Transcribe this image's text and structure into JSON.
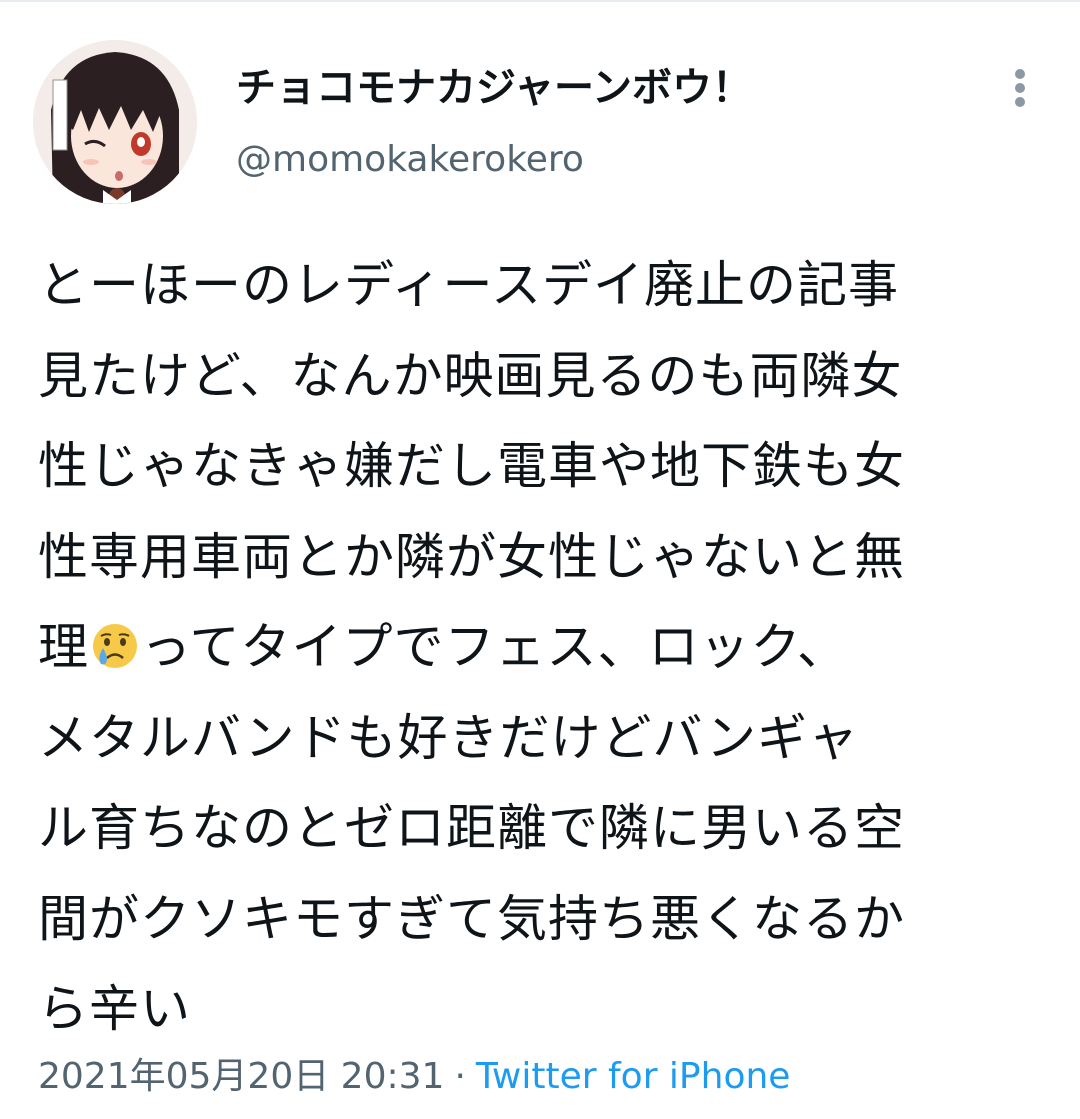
{
  "tweet": {
    "author": {
      "display_name": "チョコモナカジャーンボウ！",
      "handle": "@momokakerokero",
      "avatar_icon": "avatar-icon"
    },
    "more_icon": "more-vertical-icon",
    "text_lines": [
      "とーほーのレディースデイ廃止の記事",
      "見たけど、なんか映画見るのも両隣女",
      "性じゃなきゃ嫌だし電車や地下鉄も女",
      "性専用車両とか隣が女性じゃないと無",
      "理",
      "ってタイプでフェス、ロック、",
      "メタルバンドも好きだけどバンギャ",
      "ル育ちなのとゼロ距離で隣に男いる空",
      "間がクソキモすぎて気持ち悪くなるか",
      "ら辛い"
    ],
    "emoji": "crying-face-emoji",
    "timestamp": "2021年05月20日 20:31",
    "separator": "·",
    "source": "Twitter for iPhone"
  },
  "colors": {
    "text": "#0f1419",
    "secondary": "#536471",
    "link": "#1d9bf0"
  }
}
